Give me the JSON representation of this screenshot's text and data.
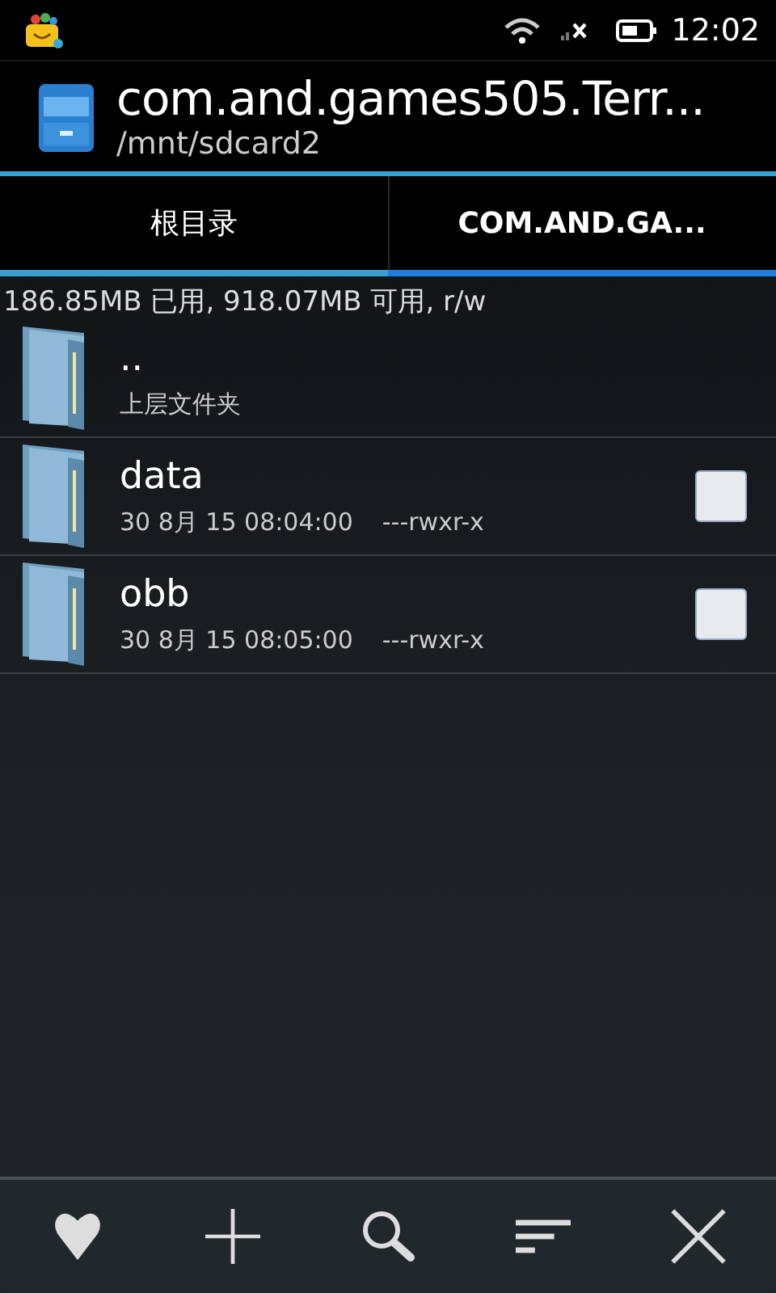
{
  "status_bar": {
    "time": "12:02"
  },
  "header": {
    "title": "com.and.games505.Terr...",
    "path": "/mnt/sdcard2"
  },
  "tabs": [
    {
      "label": "根目录",
      "selected": false
    },
    {
      "label": "COM.AND.GA...",
      "selected": true
    }
  ],
  "storage_info": "186.85MB 已用, 918.07MB 可用, r/w",
  "files": [
    {
      "kind": "parent",
      "name": "..",
      "subtitle": "上层文件夹"
    },
    {
      "kind": "folder",
      "name": "data",
      "date": "30 8月 15 08:04:00",
      "permissions": "---rwxr-x",
      "checked": false
    },
    {
      "kind": "folder",
      "name": "obb",
      "date": "30 8月 15 08:05:00",
      "permissions": "---rwxr-x",
      "checked": false
    }
  ]
}
